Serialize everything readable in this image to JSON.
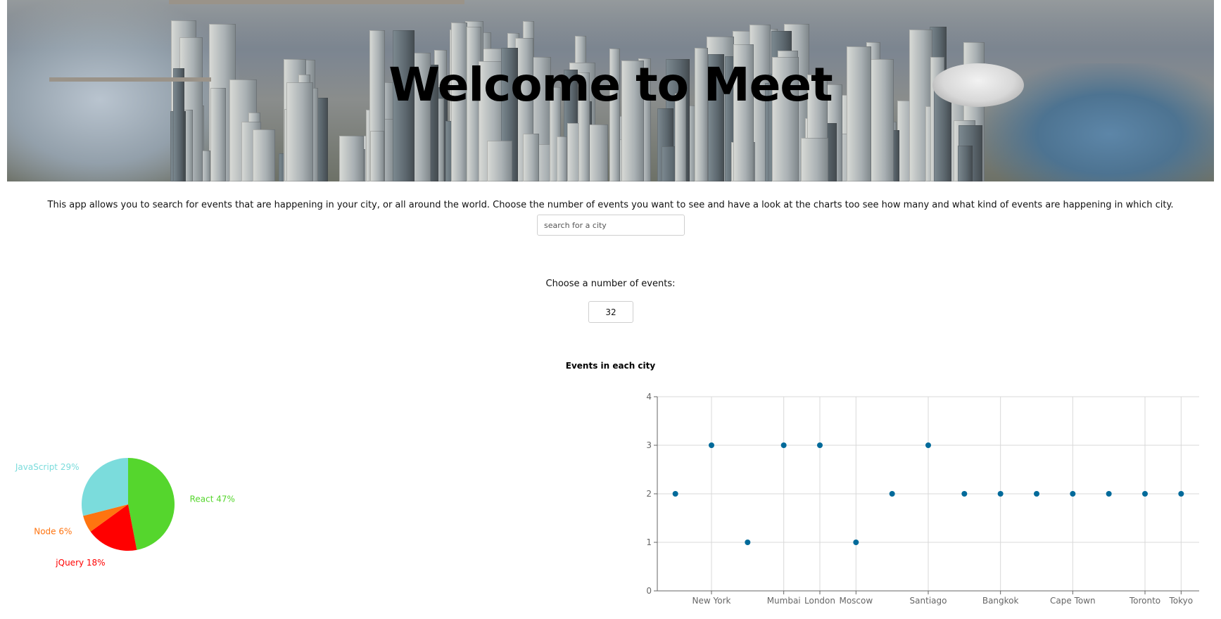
{
  "header": {
    "title": "Welcome to Meet"
  },
  "intro": {
    "text": "This app allows you to search for events that are happening in your city, or all around the world. Choose the number of events you want to see and have a look at the charts too see how many and what kind of events are happening in which city."
  },
  "search": {
    "placeholder": "search for a city",
    "value": ""
  },
  "number_of_events": {
    "label": "Choose a number of events:",
    "value": "32"
  },
  "charts": {
    "title": "Events in each city"
  },
  "chart_data": [
    {
      "type": "pie",
      "slices": [
        {
          "name": "React",
          "percent": 47,
          "label": "React 47%",
          "color": "#55d62d"
        },
        {
          "name": "jQuery",
          "percent": 18,
          "label": "jQuery 18%",
          "color": "#ff0000"
        },
        {
          "name": "Node",
          "percent": 6,
          "label": "Node 6%",
          "color": "#ff7410"
        },
        {
          "name": "JavaScript",
          "percent": 29,
          "label": "JavaScript 29%",
          "color": "#7bdcdc"
        }
      ]
    },
    {
      "type": "scatter",
      "title": "Events in each city",
      "x": [
        "",
        "New York",
        "",
        "Mumbai",
        "London",
        "Moscow",
        "",
        "Santiago",
        "",
        "Bangkok",
        "",
        "Cape Town",
        "",
        "Toronto",
        "Tokyo"
      ],
      "y": [
        2,
        3,
        1,
        3,
        3,
        1,
        2,
        3,
        2,
        2,
        2,
        2,
        2,
        2,
        2
      ],
      "ylim": [
        0,
        4
      ],
      "yticks": [
        0,
        1,
        2,
        3,
        4
      ],
      "grid": true,
      "color": "#006a9a"
    }
  ]
}
